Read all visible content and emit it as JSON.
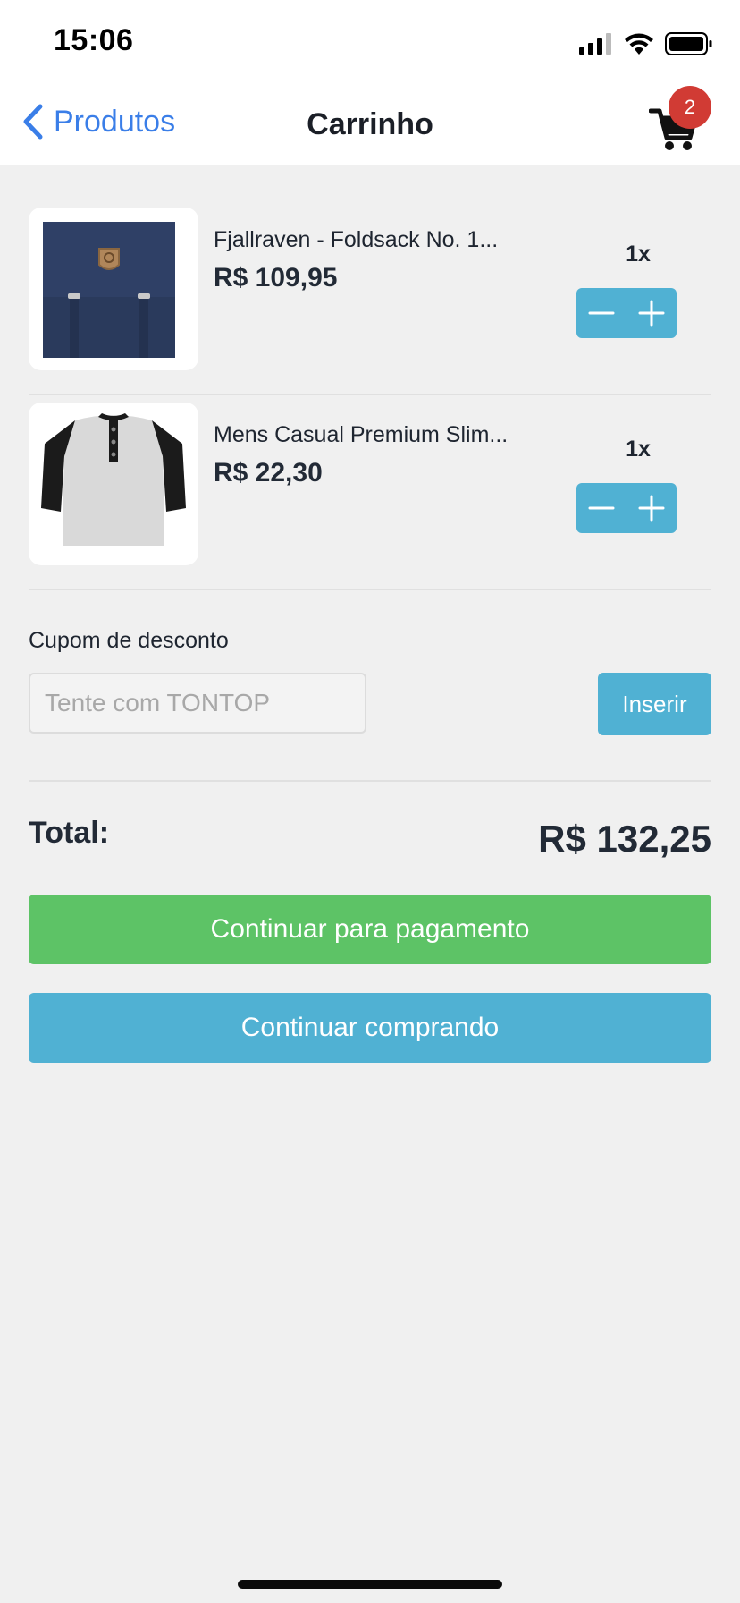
{
  "status_bar": {
    "time": "15:06"
  },
  "navbar": {
    "back_label": "Produtos",
    "title": "Carrinho",
    "cart_badge": "2"
  },
  "cart": {
    "items": [
      {
        "name": "Fjallraven - Foldsack No. 1...",
        "price": "R$ 109,95",
        "quantity": "1x",
        "image": "backpack-image"
      },
      {
        "name": "Mens Casual Premium Slim...",
        "price": "R$ 22,30",
        "quantity": "1x",
        "image": "raglan-shirt-image"
      }
    ]
  },
  "coupon": {
    "label": "Cupom de desconto",
    "placeholder": "Tente com TONTOP",
    "value": "",
    "button_label": "Inserir"
  },
  "summary": {
    "total_label": "Total:",
    "total_value": "R$ 132,25"
  },
  "actions": {
    "pay_label": "Continuar para pagamento",
    "continue_label": "Continuar comprando"
  },
  "colors": {
    "accent_blue": "#50b1d3",
    "link_blue": "#3a7ee8",
    "success_green": "#5dc366",
    "badge_red": "#d13b34",
    "background": "#f0f0f0"
  }
}
